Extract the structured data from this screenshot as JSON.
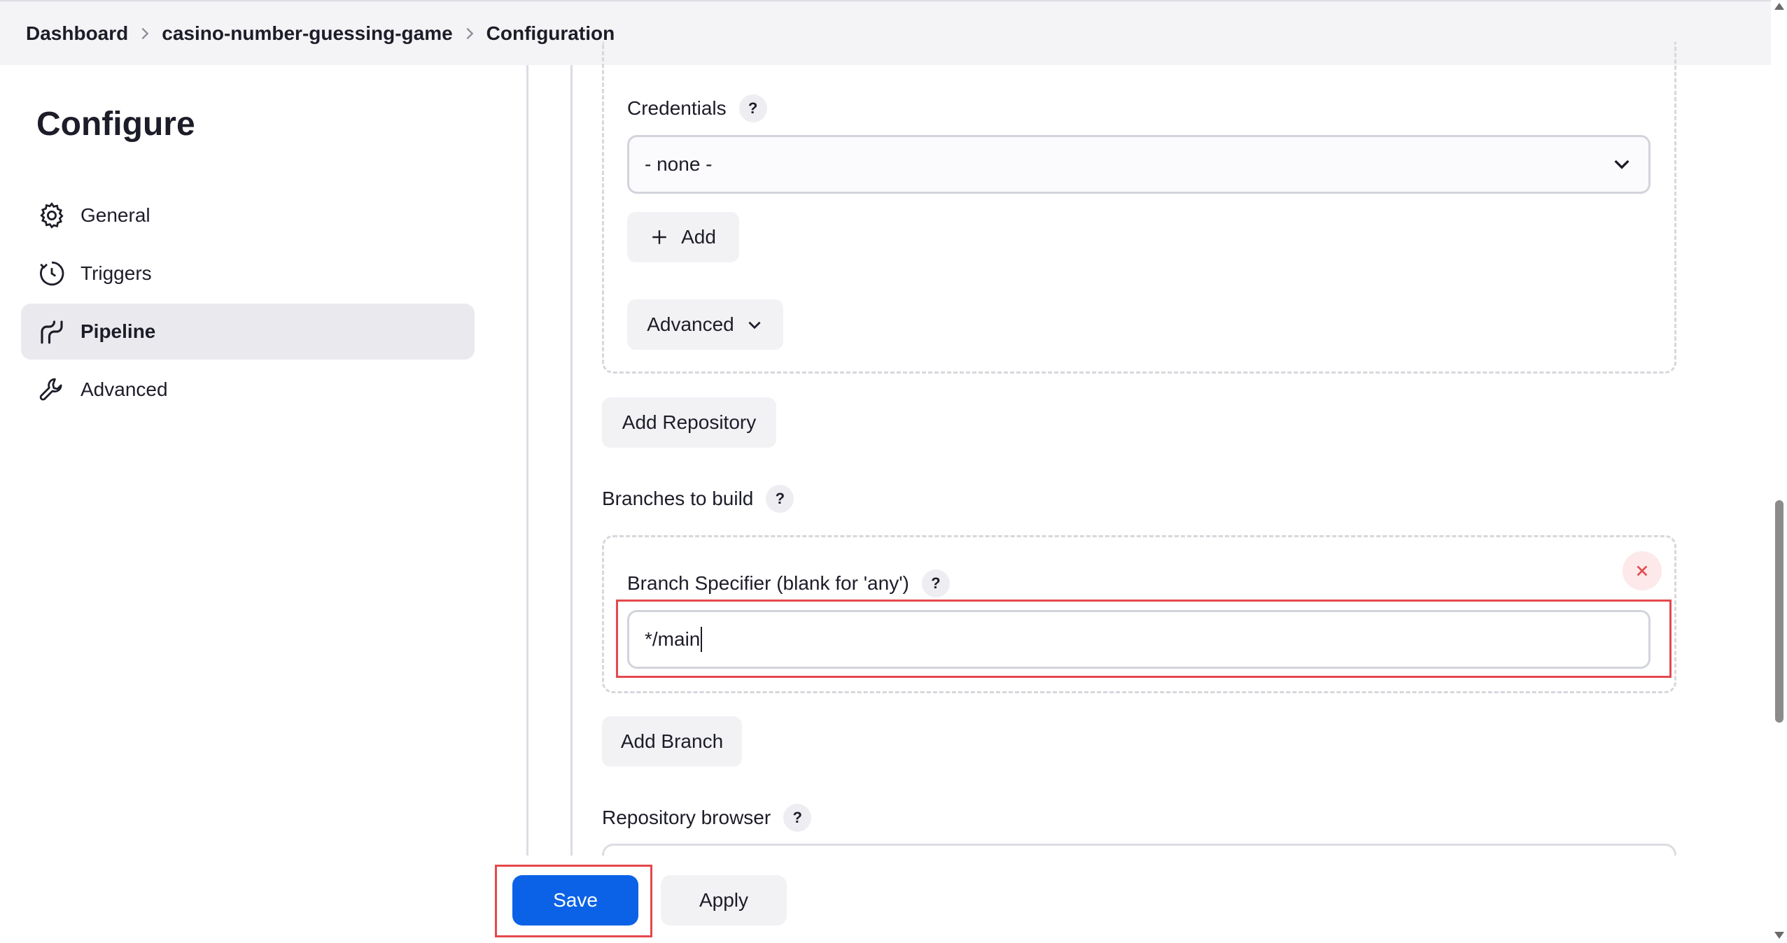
{
  "breadcrumb": {
    "items": [
      "Dashboard",
      "casino-number-guessing-game",
      "Configuration"
    ]
  },
  "sidebar": {
    "title": "Configure",
    "items": [
      {
        "label": "General",
        "icon": "gear-icon"
      },
      {
        "label": "Triggers",
        "icon": "clock-icon"
      },
      {
        "label": "Pipeline",
        "icon": "pipeline-icon",
        "active": true
      },
      {
        "label": "Advanced",
        "icon": "wrench-icon"
      }
    ]
  },
  "repository": {
    "credentials_label": "Credentials",
    "credentials_value": "- none -",
    "add_label": "Add",
    "advanced_label": "Advanced",
    "add_repository_label": "Add Repository"
  },
  "branches": {
    "section_label": "Branches to build",
    "specifier_label": "Branch Specifier (blank for 'any')",
    "specifier_value": "*/main",
    "add_branch_label": "Add Branch"
  },
  "repository_browser": {
    "label": "Repository browser"
  },
  "help_glyph": "?",
  "footer": {
    "save_label": "Save",
    "apply_label": "Apply"
  },
  "colors": {
    "primary": "#0b62e6",
    "highlight_outline": "#e5484d",
    "active_item_bg": "#eaeaee"
  }
}
